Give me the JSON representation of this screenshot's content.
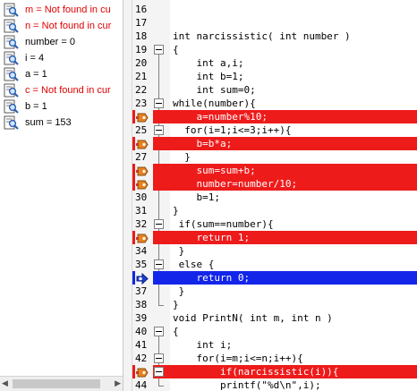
{
  "watches": [
    {
      "text": "m = Not found in cu",
      "error": true
    },
    {
      "text": "n = Not found in cur",
      "error": true
    },
    {
      "text": "number = 0",
      "error": false
    },
    {
      "text": "i = 4",
      "error": false
    },
    {
      "text": "a = 1",
      "error": false
    },
    {
      "text": "c = Not found in cur",
      "error": true
    },
    {
      "text": "b = 1",
      "error": false
    },
    {
      "text": "sum = 153",
      "error": false
    }
  ],
  "scrollbar": {
    "left_arrow": "◀",
    "right_arrow": "▶"
  },
  "lines": [
    {
      "num": "16",
      "code": "",
      "state": "normal",
      "marker": "none",
      "fold": false
    },
    {
      "num": "17",
      "code": "",
      "state": "normal",
      "marker": "none",
      "fold": false
    },
    {
      "num": "18",
      "code": "int narcissistic( int number )",
      "state": "normal",
      "marker": "none",
      "fold": false
    },
    {
      "num": "19",
      "code": "{",
      "state": "normal",
      "marker": "none",
      "fold": true
    },
    {
      "num": "20",
      "code": "    int a,i;",
      "state": "normal",
      "marker": "none",
      "fold": false
    },
    {
      "num": "21",
      "code": "    int b=1;",
      "state": "normal",
      "marker": "none",
      "fold": false
    },
    {
      "num": "22",
      "code": "    int sum=0;",
      "state": "normal",
      "marker": "none",
      "fold": false
    },
    {
      "num": "23",
      "code": "while(number){",
      "state": "normal",
      "marker": "none",
      "fold": true
    },
    {
      "num": "",
      "code": "    a=number%10;",
      "state": "breakpoint",
      "marker": "breakpoint",
      "fold": false
    },
    {
      "num": "25",
      "code": "  for(i=1;i<=3;i++){",
      "state": "normal",
      "marker": "none",
      "fold": true
    },
    {
      "num": "",
      "code": "    b=b*a;",
      "state": "breakpoint",
      "marker": "breakpoint",
      "fold": false
    },
    {
      "num": "27",
      "code": "  }",
      "state": "normal",
      "marker": "none",
      "fold": false
    },
    {
      "num": "",
      "code": "    sum=sum+b;",
      "state": "breakpoint",
      "marker": "breakpoint",
      "fold": false
    },
    {
      "num": "",
      "code": "    number=number/10;",
      "state": "breakpoint",
      "marker": "breakpoint",
      "fold": false
    },
    {
      "num": "30",
      "code": "    b=1;",
      "state": "normal",
      "marker": "none",
      "fold": false
    },
    {
      "num": "31",
      "code": "}",
      "state": "normal",
      "marker": "none",
      "fold": false
    },
    {
      "num": "32",
      "code": " if(sum==number){",
      "state": "normal",
      "marker": "none",
      "fold": true
    },
    {
      "num": "",
      "code": "    return 1;",
      "state": "breakpoint",
      "marker": "breakpoint",
      "fold": false
    },
    {
      "num": "34",
      "code": " }",
      "state": "normal",
      "marker": "none",
      "fold": false
    },
    {
      "num": "35",
      "code": " else {",
      "state": "normal",
      "marker": "none",
      "fold": true
    },
    {
      "num": "",
      "code": "    return 0;",
      "state": "current",
      "marker": "current",
      "fold": false
    },
    {
      "num": "37",
      "code": " }",
      "state": "normal",
      "marker": "none",
      "fold": false
    },
    {
      "num": "38",
      "code": "}",
      "state": "normal",
      "marker": "none",
      "fold": false
    },
    {
      "num": "39",
      "code": "void PrintN( int m, int n )",
      "state": "normal",
      "marker": "none",
      "fold": false
    },
    {
      "num": "40",
      "code": "{",
      "state": "normal",
      "marker": "none",
      "fold": true
    },
    {
      "num": "41",
      "code": "    int i;",
      "state": "normal",
      "marker": "none",
      "fold": false
    },
    {
      "num": "42",
      "code": "    for(i=m;i<=n;i++){",
      "state": "normal",
      "marker": "none",
      "fold": true
    },
    {
      "num": "",
      "code": "        if(narcissistic(i)){",
      "state": "breakpoint",
      "marker": "breakpoint",
      "fold": true
    },
    {
      "num": "44",
      "code": "        printf(\"%d\\n\",i);",
      "state": "normal",
      "marker": "none",
      "fold": false
    }
  ],
  "colors": {
    "breakpoint": "#ee1b1b",
    "current": "#1325e8",
    "error_text": "#e00000"
  }
}
